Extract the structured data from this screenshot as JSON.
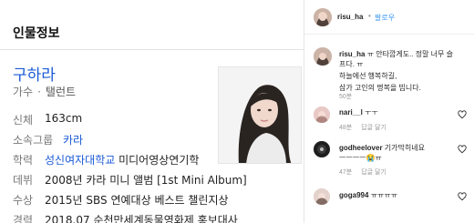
{
  "profile": {
    "title": "인물정보",
    "name": "구하라",
    "job": "가수",
    "separator": "·",
    "job_type": "탤런트",
    "rows": [
      {
        "label": "신체",
        "value": "163cm"
      },
      {
        "label": "소속그룹",
        "value": "카라"
      },
      {
        "label": "학력",
        "value_link": "성신여자대학교",
        "value_rest": " 미디어영상연기학"
      },
      {
        "label": "데뷔",
        "value": "2008년 카라 미니 앨범 [1st Mini Album]"
      },
      {
        "label": "수상",
        "value": "2015년 SBS 연예대상 베스트 챌린지상"
      },
      {
        "label": "경력",
        "value": "2018.07 순천만세계동물영화제 홍보대사"
      }
    ]
  },
  "instagram": {
    "owner": "risu_ha",
    "dot": "•",
    "follow_label": "팔로우",
    "caption": {
      "user": "risu_ha",
      "lines": [
        " ㅠ 안타깝게도.. 정말 너무 슬",
        "프다. ㅠ",
        "하늘에선 행복하길,",
        "삼가 고인의 명복을 빕니다."
      ],
      "likes": "50분"
    },
    "comments": [
      {
        "user": "nari__l",
        "text": " ㅜㅜ",
        "age": "48분",
        "reply": "답글 달기"
      },
      {
        "user": "godheelover",
        "text": " 기가막히네요",
        "text2": "ㅡㅡㅡㅡ😭ㅠ",
        "age": "47분",
        "reply": "답글 달기"
      },
      {
        "user": "goga994",
        "text": " ㅠㅠㅠㅠ",
        "age": "",
        "reply": ""
      }
    ],
    "colors": {
      "link": "#3897f0",
      "meta": "#999999",
      "text": "#262626"
    },
    "icons": [
      "heart-icon",
      "avatar"
    ]
  }
}
